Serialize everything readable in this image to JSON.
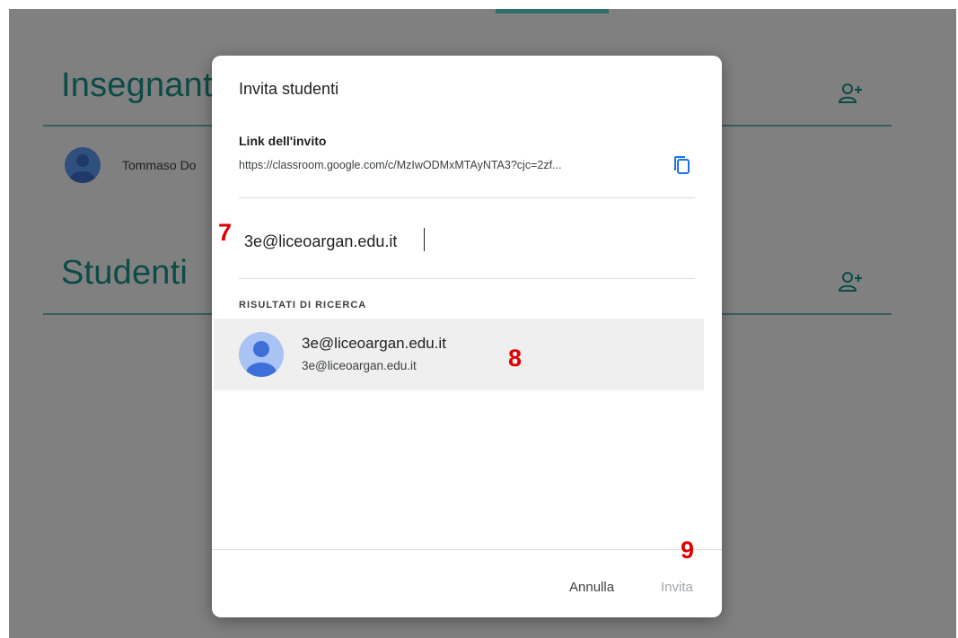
{
  "background": {
    "sections": [
      {
        "title": "Insegnanti",
        "add_icon": "add-person-icon"
      },
      {
        "title": "Studenti",
        "add_icon": "add-person-icon"
      }
    ],
    "teacher_name": "Tommaso Do"
  },
  "dialog": {
    "title": "Invita studenti",
    "link_label": "Link dell'invito",
    "link_url": "https://classroom.google.com/c/MzIwODMxMTAyNTA3?cjc=2zf...",
    "copy_icon": "copy-icon",
    "email_value": "3e@liceoargan.edu.it",
    "results_header": "RISULTATI DI RICERCA",
    "result": {
      "name": "3e@liceoargan.edu.it",
      "email": "3e@liceoargan.edu.it",
      "avatar_icon": "person-avatar-icon"
    },
    "cancel_label": "Annulla",
    "invite_label": "Invita"
  },
  "annotations": {
    "step7": "7",
    "step8": "8",
    "step9": "9"
  },
  "colors": {
    "accent_teal": "#0c4b47",
    "step_marker": "#e00000",
    "overlay_gray": "#808080"
  }
}
